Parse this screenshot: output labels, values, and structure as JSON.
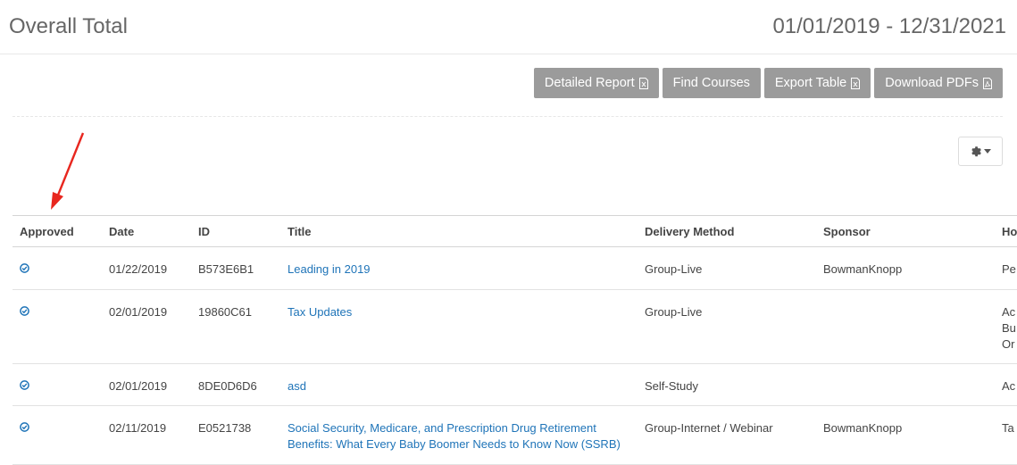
{
  "header": {
    "title": "Overall Total",
    "date_range": "01/01/2019 - 12/31/2021"
  },
  "toolbar": {
    "buttons": [
      {
        "label": "Detailed Report",
        "icon": "excel-file-icon"
      },
      {
        "label": "Find Courses"
      },
      {
        "label": "Export Table",
        "icon": "excel-file-icon"
      },
      {
        "label": "Download PDFs",
        "icon": "pdf-file-icon"
      }
    ]
  },
  "settings": {
    "icon": "gear-icon",
    "caret": "caret-down-icon"
  },
  "table": {
    "columns": [
      "Approved",
      "Date",
      "ID",
      "Title",
      "Delivery Method",
      "Sponsor",
      "Ho"
    ],
    "rows": [
      {
        "approved_icon": "check-circle-icon",
        "date": "01/22/2019",
        "id": "B573E6B1",
        "title": "Leading in 2019",
        "delivery": "Group-Live",
        "sponsor": "BowmanKnopp",
        "hours": [
          "Pe"
        ]
      },
      {
        "approved_icon": "check-circle-icon",
        "date": "02/01/2019",
        "id": "19860C61",
        "title": "Tax Updates",
        "delivery": "Group-Live",
        "sponsor": "",
        "hours": [
          "Ac",
          "Bu",
          "Or"
        ]
      },
      {
        "approved_icon": "check-circle-icon",
        "date": "02/01/2019",
        "id": "8DE0D6D6",
        "title": "asd",
        "delivery": "Self-Study",
        "sponsor": "",
        "hours": [
          "Ac"
        ]
      },
      {
        "approved_icon": "check-circle-icon",
        "date": "02/11/2019",
        "id": "E0521738",
        "title": "Social Security, Medicare, and Prescription Drug Retirement Benefits: What Every Baby Boomer Needs to Know Now (SSRB)",
        "delivery": "Group-Internet / Webinar",
        "sponsor": "BowmanKnopp",
        "hours": [
          "Ta"
        ]
      }
    ]
  },
  "colors": {
    "accent": "#1f74b8",
    "button_bg": "#9b9b9b",
    "arrow": "#e8271f"
  }
}
